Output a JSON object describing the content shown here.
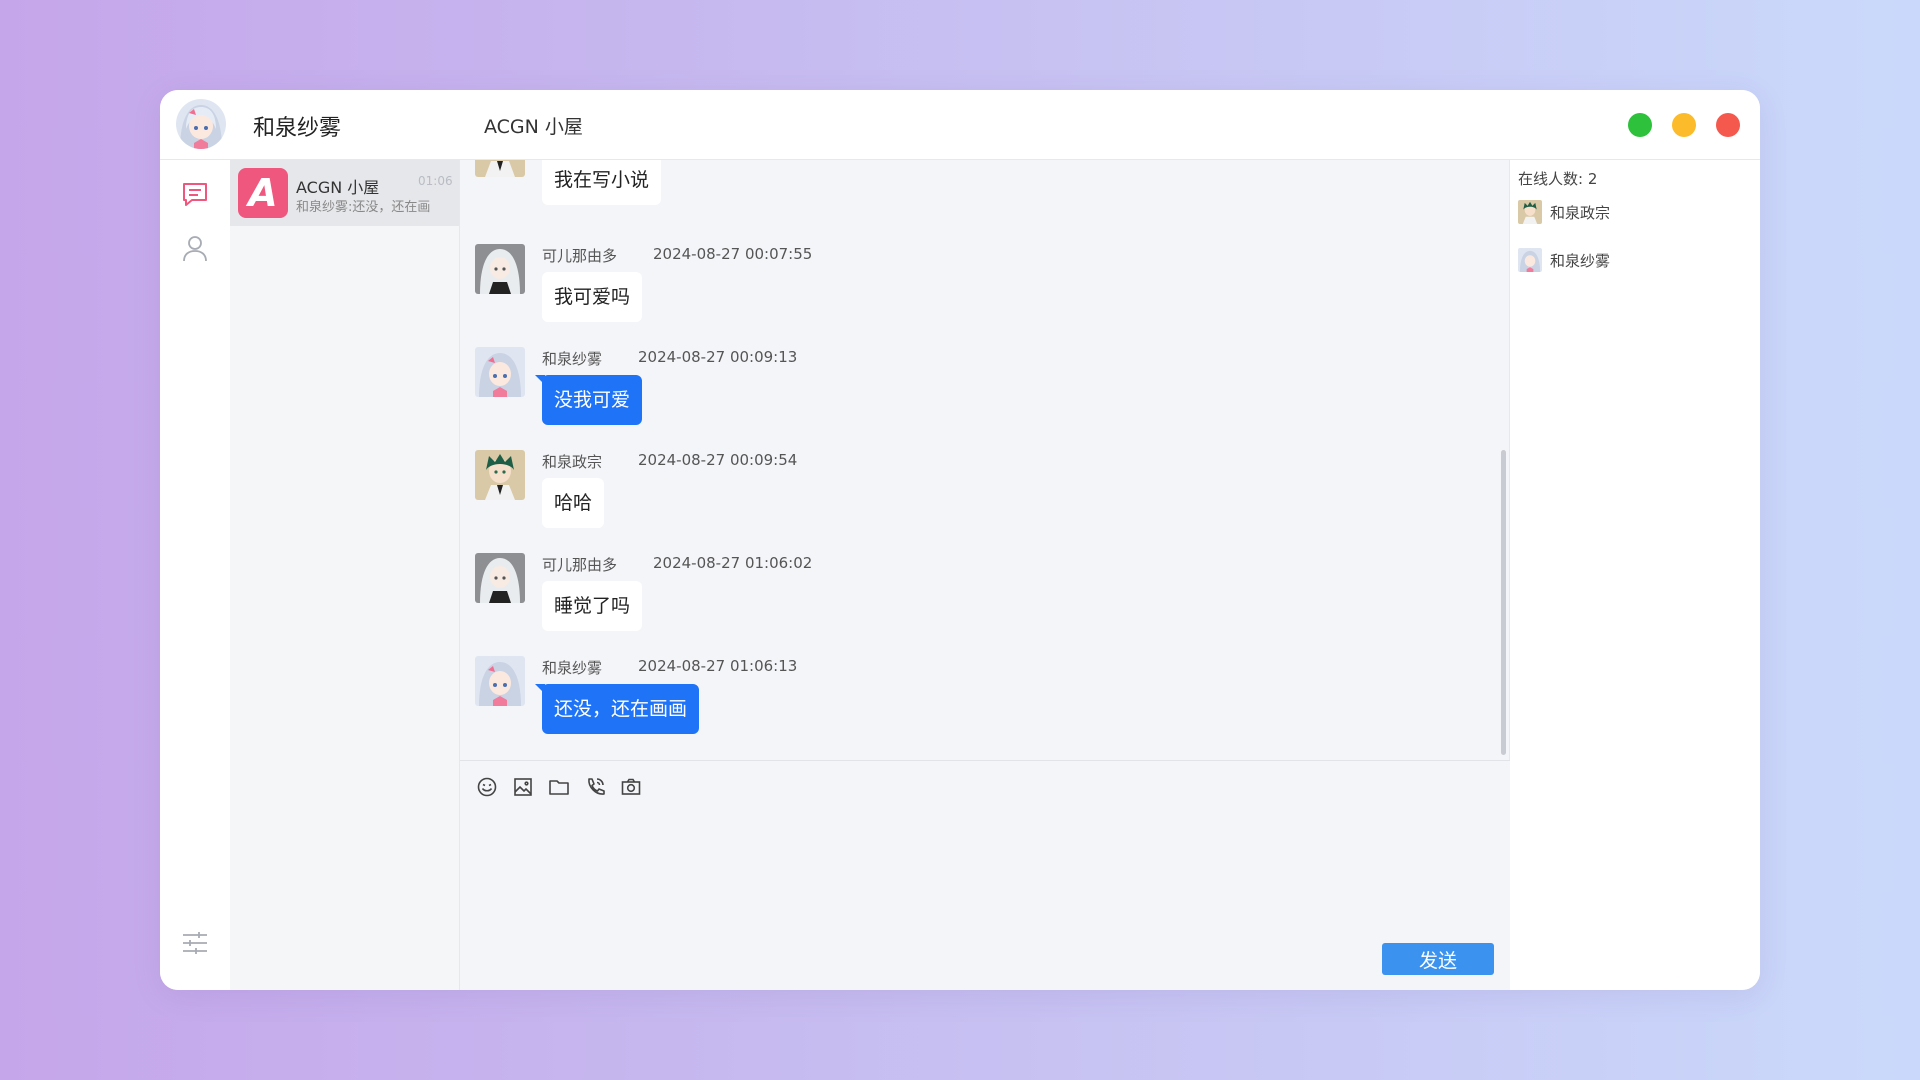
{
  "header": {
    "user_name": "和泉纱雾",
    "room_title": "ACGN 小屋"
  },
  "colors": {
    "accent": "#1f73f7",
    "send_button": "#3c93ef",
    "win_green": "#2ec13b",
    "win_yellow": "#fbbb2a",
    "win_red": "#f5594e",
    "room_logo": "#f0577e"
  },
  "rail": {
    "icons": [
      "chat-bubble-icon",
      "user-icon",
      "settings-sliders-icon"
    ]
  },
  "conversations": [
    {
      "logo_letter": "A",
      "name": "ACGN 小屋",
      "time": "01:06",
      "preview": "和泉纱雾:还没，还在画"
    }
  ],
  "messages": [
    {
      "bubble": "我在写小说",
      "mine": false
    },
    {
      "sender": "可儿那由多",
      "time": "2024-08-27 00:07:55",
      "bubble": "我可爱吗",
      "mine": false
    },
    {
      "sender": "和泉纱雾",
      "time": "2024-08-27 00:09:13",
      "bubble": "没我可爱",
      "mine": true
    },
    {
      "sender": "和泉政宗",
      "time": "2024-08-27 00:09:54",
      "bubble": "哈哈",
      "mine": false
    },
    {
      "sender": "可儿那由多",
      "time": "2024-08-27 01:06:02",
      "bubble": "睡觉了吗",
      "mine": false
    },
    {
      "sender": "和泉纱雾",
      "time": "2024-08-27 01:06:13",
      "bubble": "还没，还在画画",
      "mine": true
    }
  ],
  "composer": {
    "tools": [
      "emoji-icon",
      "image-icon",
      "folder-icon",
      "phone-icon",
      "camera-icon"
    ],
    "send_label": "发送"
  },
  "online": {
    "count_label": "在线人数:  2",
    "users": [
      {
        "name": "和泉政宗"
      },
      {
        "name": "和泉纱雾"
      }
    ]
  }
}
